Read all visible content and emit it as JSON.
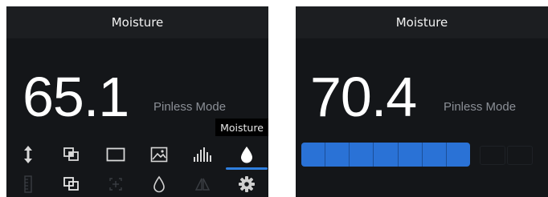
{
  "left": {
    "title": "Moisture",
    "reading": "65.1",
    "mode": "Pinless Mode",
    "tooltip": "Moisture",
    "toolbar": [
      {
        "icon": "arrow-updown-icon",
        "active": false
      },
      {
        "icon": "overlap-squares-icon",
        "active": false
      },
      {
        "icon": "rectangle-icon",
        "active": false
      },
      {
        "icon": "image-icon",
        "active": false
      },
      {
        "icon": "bar-chart-icon",
        "active": false
      },
      {
        "icon": "moisture-drop-icon",
        "active": true
      }
    ],
    "toolbar2": [
      {
        "icon": "ruler-icon"
      },
      {
        "icon": "overlap-squares-icon"
      },
      {
        "icon": "crosshair-icon"
      },
      {
        "icon": "drop-outline-icon"
      },
      {
        "icon": "mirror-icon"
      },
      {
        "icon": "gear-icon"
      }
    ],
    "accent": "#2f7fe0"
  },
  "right": {
    "title": "Moisture",
    "reading": "70.4",
    "mode": "Pinless Mode",
    "bar_segments_filled": 7,
    "bar_segments_total": 10,
    "bar_color": "#2a72d6"
  }
}
